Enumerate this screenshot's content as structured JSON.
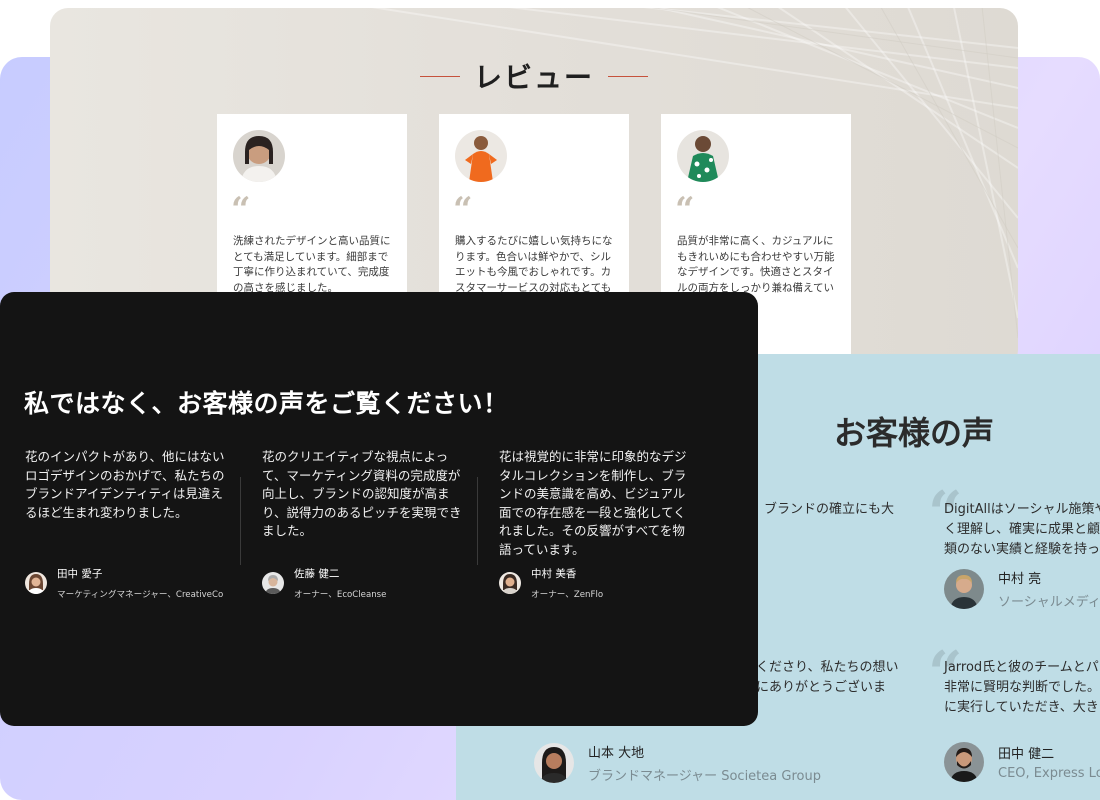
{
  "review": {
    "title": "レビュー",
    "quote_mark": "“",
    "cards": [
      {
        "avatar_icon": "woman-portrait",
        "text": "洗練されたデザインと高い品質にとても満足しています。細部まで丁寧に作り込まれていて、完成度の高さを感じました。"
      },
      {
        "avatar_icon": "woman-orange-dress-portrait",
        "text": "購入するたびに嬉しい気持ちになります。色合いは鮮やかで、シルエットも今風でおしゃれです。カスタマーサービスの対応もとても"
      },
      {
        "avatar_icon": "woman-green-dress-portrait",
        "text": "品質が非常に高く、カジュアルにもきれいめにも合わせやすい万能なデザインです。快適さとスタイルの両方をしっかり兼ね備えてい"
      }
    ]
  },
  "voices": {
    "title": "お客様の声",
    "quote_mark": "“",
    "items": [
      {
        "lines": [
          "ブランドの確立にも大"
        ]
      },
      {
        "lines": [
          "DigitAllはソーシャル施策や",
          "く理解し、確実に成果と顧",
          "類のない実績と経験を持っ"
        ],
        "name": "中村 亮",
        "role": "ソーシャルメディ",
        "avatar_icon": "man-portrait"
      },
      {
        "lines": [
          "くださり、私たちの想い",
          "にありがとうございま"
        ],
        "name": "山本 大地",
        "role": "ブランドマネージャー Societea Group",
        "avatar_icon": "woman-portrait"
      },
      {
        "lines": [
          "Jarrod氏と彼のチームとパ",
          "非常に賢明な判断でした。",
          "に実行していただき、大き"
        ],
        "name": "田中 健二",
        "role": "CEO, Express Log",
        "avatar_icon": "man-beard-portrait"
      }
    ]
  },
  "dark": {
    "title": "私ではなく、お客様の声をご覧ください！",
    "columns": [
      {
        "text": "花のインパクトがあり、他にはないロゴデザインのおかげで、私たちのブランドアイデンティティは見違えるほど生まれ変わりました。",
        "name": "田中 愛子",
        "role": "マーケティングマネージャー、CreativeCo",
        "avatar_icon": "woman-portrait"
      },
      {
        "text": "花のクリエイティブな視点によって、マーケティング資料の完成度が向上し、ブランドの認知度が高まり、説得力のあるピッチを実現できました。",
        "name": "佐藤 健二",
        "role": "オーナー、EcoCleanse",
        "avatar_icon": "man-gray-hair-portrait"
      },
      {
        "text": "花は視覚的に非常に印象的なデジタルコレクションを制作し、ブランドの美意識を高め、ビジュアル面での存在感を一段と強化してくれました。その反響がすべてを物語っています。",
        "name": "中村 美香",
        "role": "オーナー、ZenFlo",
        "avatar_icon": "woman-portrait"
      }
    ]
  }
}
